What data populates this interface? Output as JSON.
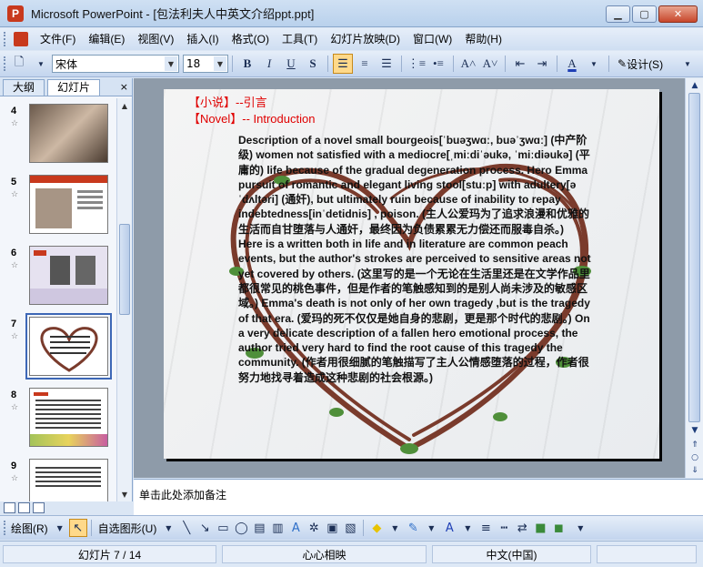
{
  "window": {
    "title": "Microsoft PowerPoint - [包法利夫人中英文介绍ppt.ppt]",
    "app_icon": "P"
  },
  "menu": [
    "文件(F)",
    "编辑(E)",
    "视图(V)",
    "插入(I)",
    "格式(O)",
    "工具(T)",
    "幻灯片放映(D)",
    "窗口(W)",
    "帮助(H)"
  ],
  "format_toolbar": {
    "font_name": "宋体",
    "font_size": "18",
    "bold": "B",
    "italic": "I",
    "underline": "U",
    "design_label": "设计(S)"
  },
  "left_panel": {
    "tabs": [
      "大纲",
      "幻灯片"
    ],
    "close_glyph": "×",
    "slide_numbers": [
      "4",
      "5",
      "6",
      "7",
      "8",
      "9"
    ],
    "selected_slide": "7"
  },
  "slide": {
    "title_cn": "【小说】--引言",
    "title_en": "【Novel】-- Introduction",
    "body": "Description of a novel small bourgeois[ˈbuəʒwɑː, buəˈʒwɑː] (中产阶级) women not satisfied with a mediocre[ˌmiːdiˈəukə, ˈmiːdiəukə] (平庸的) life because of the gradual degeneration process. Hero Emma pursuit of romantic and elegant living stool[stuːp] with adultery[əˈdʌltəri] (通奸), but ultimately ruin because of inability to repay indebtedness[inˈdetidnis] , poison. (主人公爱玛为了追求浪漫和优雅的生活而自甘堕落与人通奸，最终因为负债累累无力偿还而服毒自杀。) Here is a written both in life and in literature are common peach events, but the author's strokes are perceived to sensitive areas not yet covered by others. (这里写的是一个无论在生活里还是在文学作品里都很常见的桃色事件，但是作者的笔触感知到的是别人尚未涉及的敏感区域。) Emma's death is not only of her own tragedy ,but is the tragedy of that era. (爱玛的死不仅仅是她自身的悲剧，更是那个时代的悲剧。) On a very delicate description of a fallen hero emotional process, the author tried very hard to find the root cause of this tragedy the community. (作者用很细腻的笔触描写了主人公情感堕落的过程，作者很努力地找寻着造成这种悲剧的社会根源。)"
  },
  "notes_placeholder": "单击此处添加备注",
  "draw_toolbar": {
    "draw_label": "绘图(R)",
    "autoshape_label": "自选图形(U)"
  },
  "status": {
    "slide_info": "幻灯片 7 / 14",
    "design": "心心相映",
    "language": "中文(中国)"
  },
  "colors": {
    "title_red": "#e00000",
    "frame_blue": "#dbe6f4"
  }
}
